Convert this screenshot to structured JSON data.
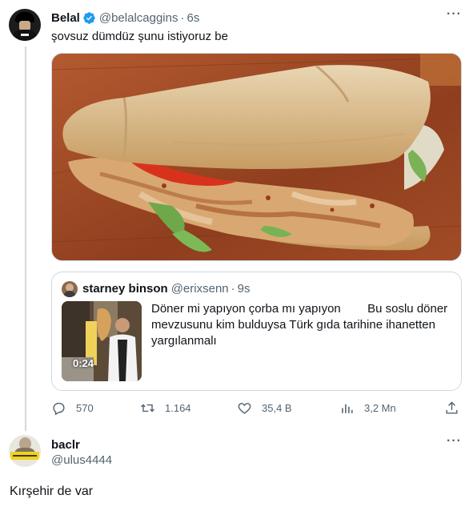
{
  "colors": {
    "accent": "#1d9bf0",
    "muted": "#536471",
    "text": "#0f1419",
    "border": "#cfd9de"
  },
  "tweet": {
    "author_name": "Belal",
    "handle": "@belalcaggins",
    "separator": "·",
    "time": "6s",
    "text": "şovsuz dümdüz şunu istiyoruz be",
    "more_icon": "more-icon",
    "media_alt": "sandwich-photo"
  },
  "quoted": {
    "author_name": "starney binson",
    "handle": "@erixsenn",
    "separator": "·",
    "time": "9s",
    "video_duration": "0:24",
    "text": "Döner mi yapıyon çorba mı yapıyon        Bu soslu döner mevzusunu kim bulduysa Türk gıda tarihine ihanetten yargılanmalı"
  },
  "actions": {
    "replies": "570",
    "retweets": "1.164",
    "likes": "35,4 B",
    "views": "3,2 Mn"
  },
  "reply": {
    "author_name": "baclr",
    "handle": "@ulus4444",
    "text": "Kırşehir de var"
  }
}
